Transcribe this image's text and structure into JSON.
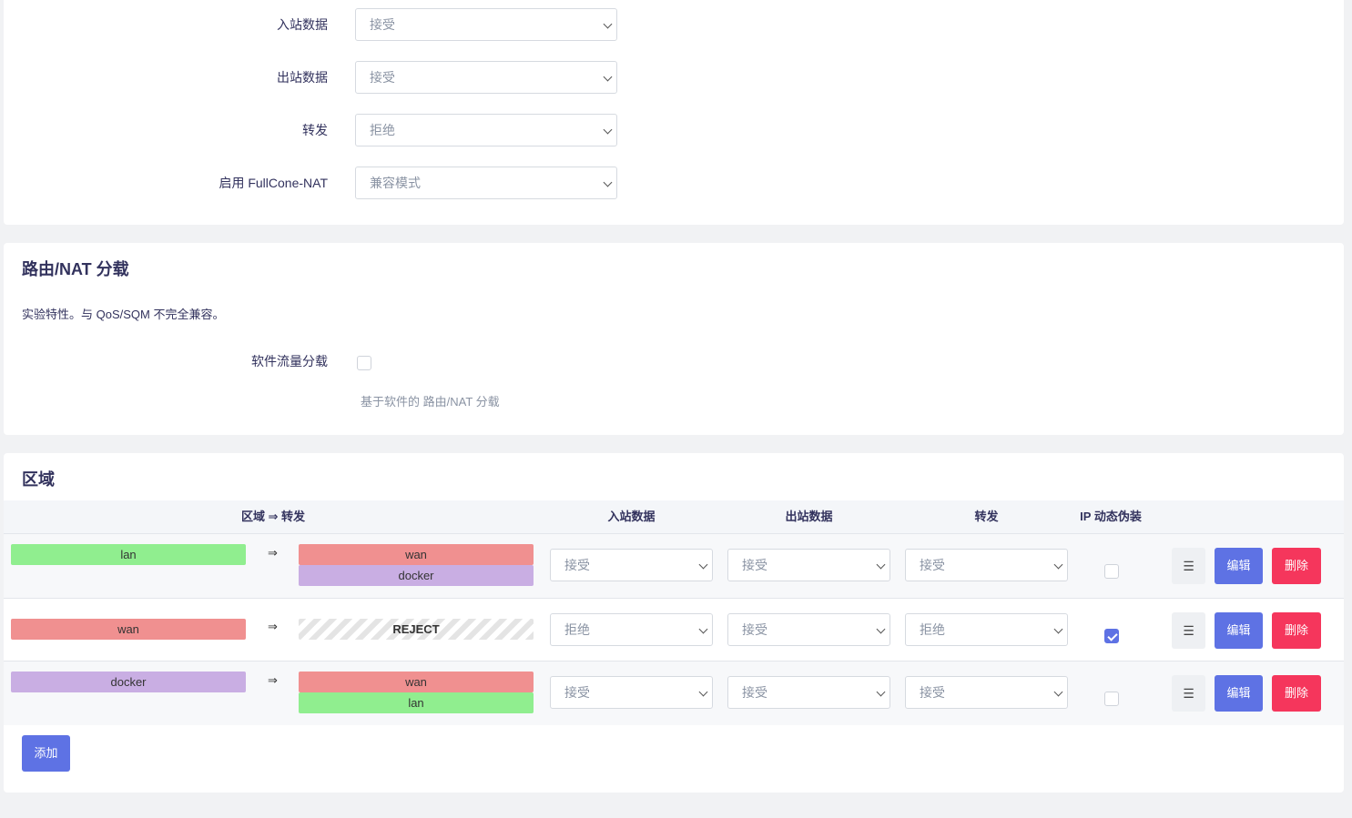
{
  "colors": {
    "primary": "#5e72e4",
    "danger": "#f5365c",
    "zone_lan": "#90ee8f",
    "zone_wan": "#f09090",
    "zone_docker": "#c9aee3"
  },
  "general": {
    "input_label": "入站数据",
    "input_value": "接受",
    "output_label": "出站数据",
    "output_value": "接受",
    "forward_label": "转发",
    "forward_value": "拒绝",
    "fullcone_label": "启用 FullCone-NAT",
    "fullcone_value": "兼容模式"
  },
  "offload": {
    "title": "路由/NAT 分载",
    "description": "实验特性。与 QoS/SQM 不完全兼容。",
    "sw_label": "软件流量分载",
    "sw_checked": false,
    "sw_hint": "基于软件的 路由/NAT 分载"
  },
  "zones": {
    "title": "区域",
    "headers": {
      "zone_forward": "区域 ⇒ 转发",
      "input": "入站数据",
      "output": "出站数据",
      "forward": "转发",
      "masq": "IP 动态伪装"
    },
    "arrow": "⇒",
    "menu_icon": "☰",
    "edit_label": "编辑",
    "delete_label": "删除",
    "add_label": "添加",
    "rows": [
      {
        "zone": "lan",
        "dest": [
          "wan",
          "docker"
        ],
        "input": "接受",
        "output": "接受",
        "forward": "接受",
        "masq": false
      },
      {
        "zone": "wan",
        "dest": [
          "REJECT"
        ],
        "input": "拒绝",
        "output": "接受",
        "forward": "拒绝",
        "masq": true
      },
      {
        "zone": "docker",
        "dest": [
          "wan",
          "lan"
        ],
        "input": "接受",
        "output": "接受",
        "forward": "接受",
        "masq": false
      }
    ]
  }
}
